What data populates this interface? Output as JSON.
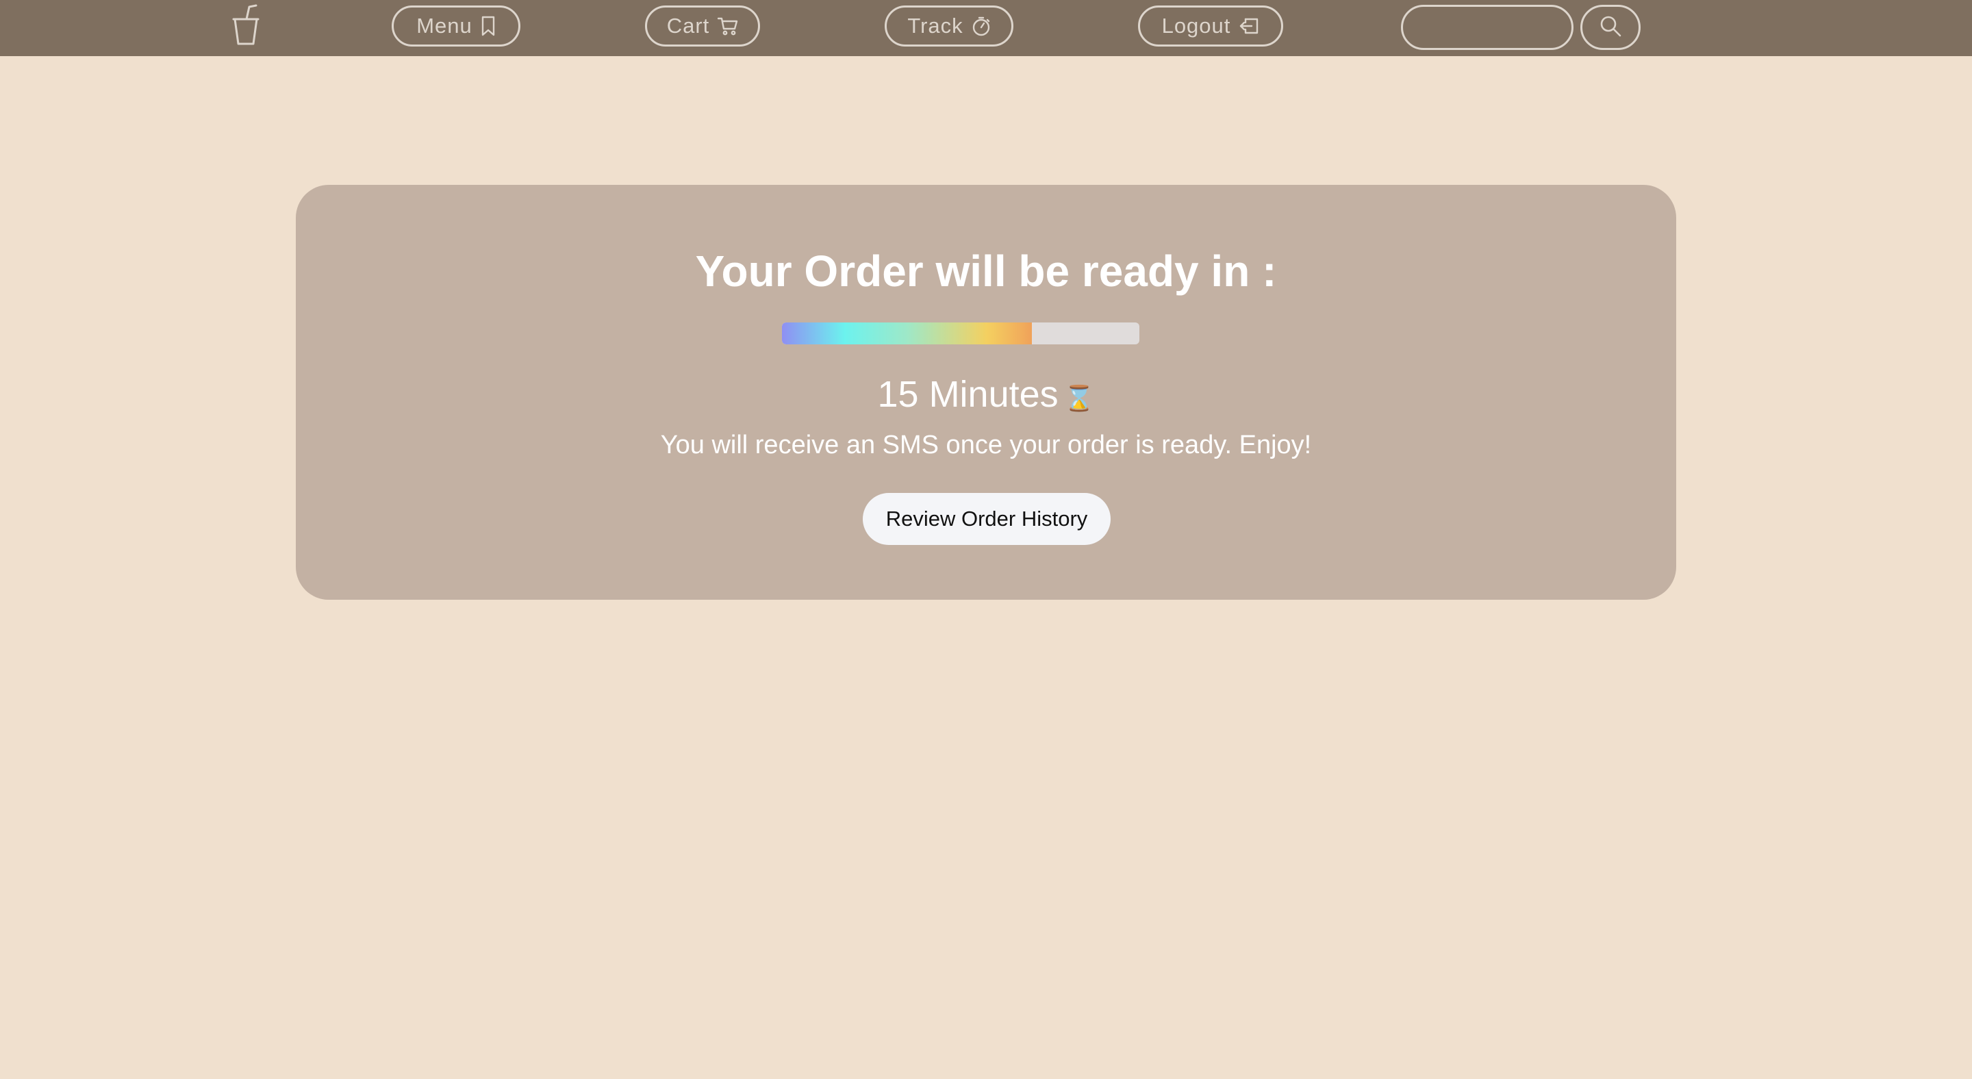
{
  "nav": {
    "logo_icon": "cup-with-straw-icon",
    "items": [
      {
        "label": "Menu",
        "icon": "bookmark-icon"
      },
      {
        "label": "Cart",
        "icon": "cart-icon"
      },
      {
        "label": "Track",
        "icon": "stopwatch-icon"
      },
      {
        "label": "Logout",
        "icon": "logout-icon"
      }
    ],
    "search": {
      "value": "",
      "placeholder": "",
      "icon": "search-icon"
    }
  },
  "order": {
    "title": "Your Order will be ready in :",
    "progress_percent": 70,
    "time_text": "15 Minutes",
    "time_icon": "⌛",
    "message": "You will receive an SMS once your order is ready. Enjoy!",
    "history_button_label": "Review Order History"
  },
  "colors": {
    "navbar": "#7f6f5f",
    "background": "#f0e0ce",
    "card": "#c3b1a3",
    "nav_text": "#ddd5cc",
    "button_bg": "#f4f5f8"
  }
}
